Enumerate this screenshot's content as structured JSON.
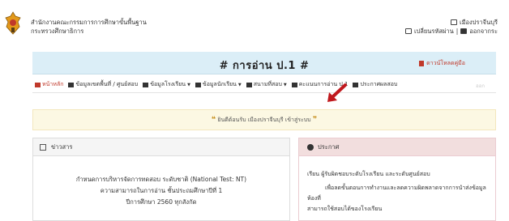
{
  "header": {
    "org_line1": "สำนักงานคณะกรรมการการศึกษาขั้นพื้นฐาน",
    "org_line2": "กระทรวงศึกษาธิการ",
    "user_name": "เมืองปราจีนบุรี",
    "change_password": "เปลี่ยนรหัสผ่าน",
    "logout": "ออกจากระ"
  },
  "title_bar": {
    "title": "# การอ่าน ป.1 #",
    "download": "ดาวน์โหลดคู่มือ"
  },
  "nav": {
    "items": [
      {
        "label": "หน้าหลัก",
        "icon": "home-icon"
      },
      {
        "label": "ข้อมูลเขตพื้นที่ / ศูนย์สอบ",
        "icon": "bank-icon"
      },
      {
        "label": "ข้อมูลโรงเรียน",
        "icon": "school-icon",
        "dropdown": true
      },
      {
        "label": "ข้อมูลนักเรียน",
        "icon": "graduation-cap-icon",
        "dropdown": true
      },
      {
        "label": "สนามที่สอบ",
        "icon": "table-icon",
        "dropdown": true
      },
      {
        "label": "คะแนนการอ่าน ป.1",
        "icon": "download-icon"
      },
      {
        "label": "ประกาศผลสอบ",
        "icon": "megaphone-icon"
      }
    ],
    "right_faint": "ออก"
  },
  "welcome": {
    "text": "ยินดีต้อนรับ เมืองปราจีนบุรี เข้าสู่ระบบ"
  },
  "news": {
    "heading": "ข่าวสาร",
    "line1": "กำหนดการบริหารจัดการทดสอบ ระดับชาติ (National Test: NT)",
    "line2": "ความสามารถในการอ่าน ชั้นประถมศึกษาปีที่ 1",
    "line3": "ปีการศึกษา 2560 ทุกสังกัด"
  },
  "notice": {
    "heading": "ประกาศ",
    "line1": "เรียน ผู้รับผิดชอบระดับโรงเรียน และระดับศูนย์สอบ",
    "line2": "เพื่อลดขั้นตอนการทำงานและลดความผิดพลาดจากการนำส่งข้อมูลห้องที่",
    "line3": "สามารถใช้สอบได้ของโรงเรียน"
  },
  "colors": {
    "title_bg": "#dbeef7",
    "accent_red": "#c0392b",
    "welcome_bg": "#fcf8e3",
    "notice_head_bg": "#f2dede"
  }
}
